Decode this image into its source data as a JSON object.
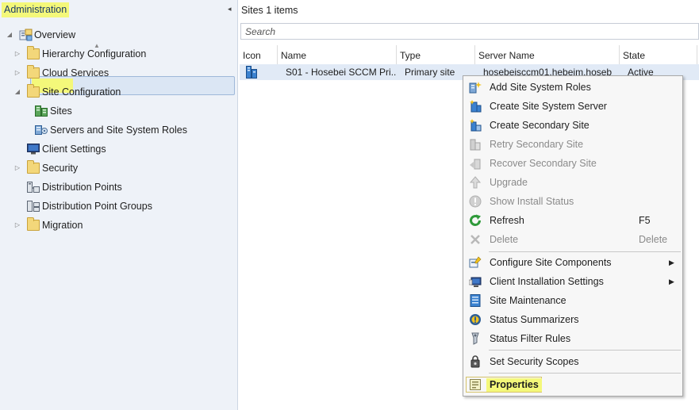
{
  "nav": {
    "title": "Administration",
    "collapse_glyph": "◂",
    "tree": [
      {
        "label": "Overview",
        "icon": "overview-icon",
        "expander": "◢"
      },
      {
        "label": "Hierarchy Configuration",
        "icon": "folder-icon",
        "expander": "▷"
      },
      {
        "label": "Cloud Services",
        "icon": "folder-icon",
        "expander": "▷"
      },
      {
        "label": "Site Configuration",
        "icon": "folder-icon",
        "expander": "◢"
      },
      {
        "label": "Sites",
        "icon": "sites-icon",
        "expander": ""
      },
      {
        "label": "Servers and Site System Roles",
        "icon": "server-roles-icon",
        "expander": ""
      },
      {
        "label": "Client Settings",
        "icon": "client-settings-icon",
        "expander": ""
      },
      {
        "label": "Security",
        "icon": "folder-icon",
        "expander": "▷"
      },
      {
        "label": "Distribution Points",
        "icon": "distribution-point-icon",
        "expander": ""
      },
      {
        "label": "Distribution Point Groups",
        "icon": "distribution-point-groups-icon",
        "expander": ""
      },
      {
        "label": "Migration",
        "icon": "folder-icon",
        "expander": "▷"
      }
    ]
  },
  "content": {
    "title": "Sites 1 items",
    "search_placeholder": "Search",
    "sort_glyph": "▲",
    "columns": [
      "Icon",
      "Name",
      "Type",
      "Server Name",
      "State"
    ],
    "rows": [
      {
        "name": "S01 - Hosebei SCCM Pri...",
        "type": "Primary site",
        "server": "hosebeisccm01.hebeim.hoseb",
        "state": "Active"
      }
    ]
  },
  "context_menu": {
    "items": [
      {
        "label": "Add Site System Roles",
        "icon": "add-site-system-roles-icon",
        "enabled": true
      },
      {
        "label": "Create Site System Server",
        "icon": "create-site-system-server-icon",
        "enabled": true
      },
      {
        "label": "Create Secondary Site",
        "icon": "create-secondary-site-icon",
        "enabled": true
      },
      {
        "label": "Retry Secondary Site",
        "icon": "retry-secondary-site-icon",
        "enabled": false
      },
      {
        "label": "Recover Secondary Site",
        "icon": "recover-secondary-site-icon",
        "enabled": false
      },
      {
        "label": "Upgrade",
        "icon": "upgrade-icon",
        "enabled": false
      },
      {
        "label": "Show Install Status",
        "icon": "install-status-icon",
        "enabled": false
      },
      {
        "label": "Refresh",
        "icon": "refresh-icon",
        "enabled": true,
        "shortcut": "F5"
      },
      {
        "label": "Delete",
        "icon": "delete-icon",
        "enabled": false,
        "shortcut": "Delete"
      },
      {
        "label": "Configure Site Components",
        "icon": "configure-site-components-icon",
        "enabled": true,
        "submenu_glyph": "▶"
      },
      {
        "label": "Client Installation Settings",
        "icon": "client-installation-settings-icon",
        "enabled": true,
        "submenu_glyph": "▶"
      },
      {
        "label": "Site Maintenance",
        "icon": "site-maintenance-icon",
        "enabled": true
      },
      {
        "label": "Status Summarizers",
        "icon": "status-summarizers-icon",
        "enabled": true
      },
      {
        "label": "Status Filter Rules",
        "icon": "status-filter-rules-icon",
        "enabled": true
      },
      {
        "label": "Set Security Scopes",
        "icon": "security-scopes-icon",
        "enabled": true
      },
      {
        "label": "Properties",
        "icon": "properties-icon",
        "enabled": true
      }
    ]
  },
  "colors": {
    "highlight": "#f4f87a",
    "selection": "#dbe6f4",
    "pane_background": "#eef2f8",
    "disabled_text": "#8a8a8a"
  }
}
